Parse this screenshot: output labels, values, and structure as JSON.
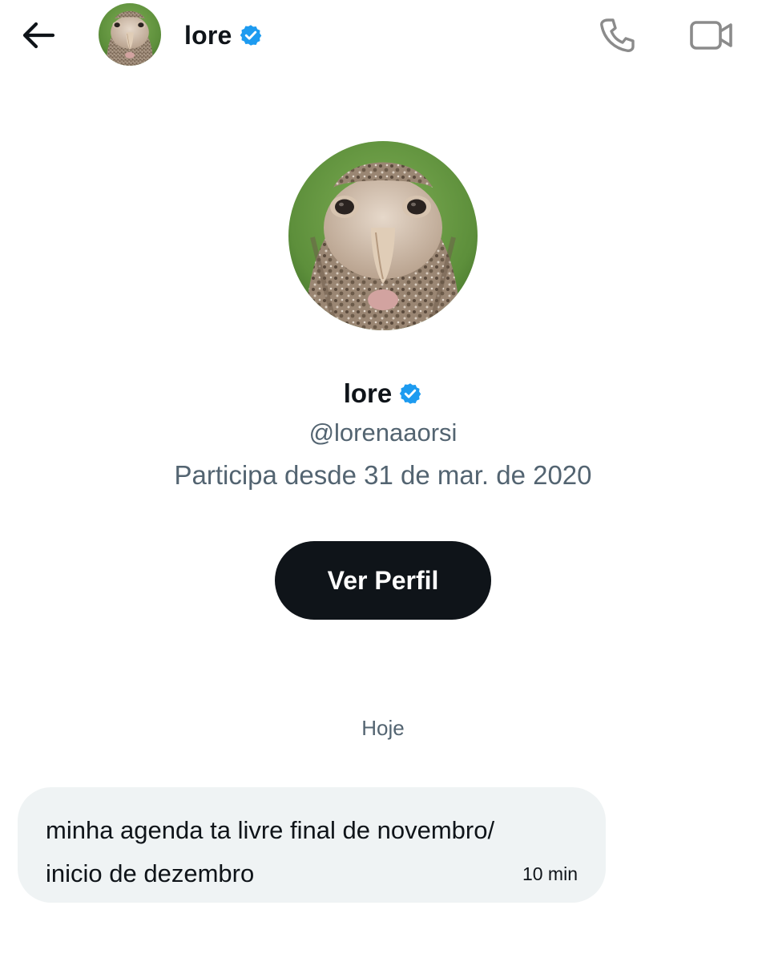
{
  "header": {
    "back_icon": "arrow-left-icon",
    "name": "lore",
    "verified_icon": "verified-badge-icon",
    "call_icon": "phone-icon",
    "video_icon": "video-camera-icon",
    "avatar": "owl-photo"
  },
  "profile": {
    "avatar": "owl-photo",
    "name": "lore",
    "verified_icon": "verified-badge-icon",
    "handle": "@lorenaaorsi",
    "joined": "Participa desde 31 de mar. de 2020",
    "view_profile_label": "Ver Perfil"
  },
  "conversation": {
    "date_separator": "Hoje",
    "messages": [
      {
        "lines": [
          "minha agenda ta livre final de novembro/",
          "inicio de dezembro"
        ],
        "time": "10 min"
      }
    ]
  },
  "colors": {
    "text_primary": "#0f1419",
    "text_secondary": "#536471",
    "verified_blue": "#1d9bf0",
    "bubble_bg": "#eff3f4",
    "button_bg": "#0f1419",
    "icon_gray": "#8b8b8b"
  }
}
